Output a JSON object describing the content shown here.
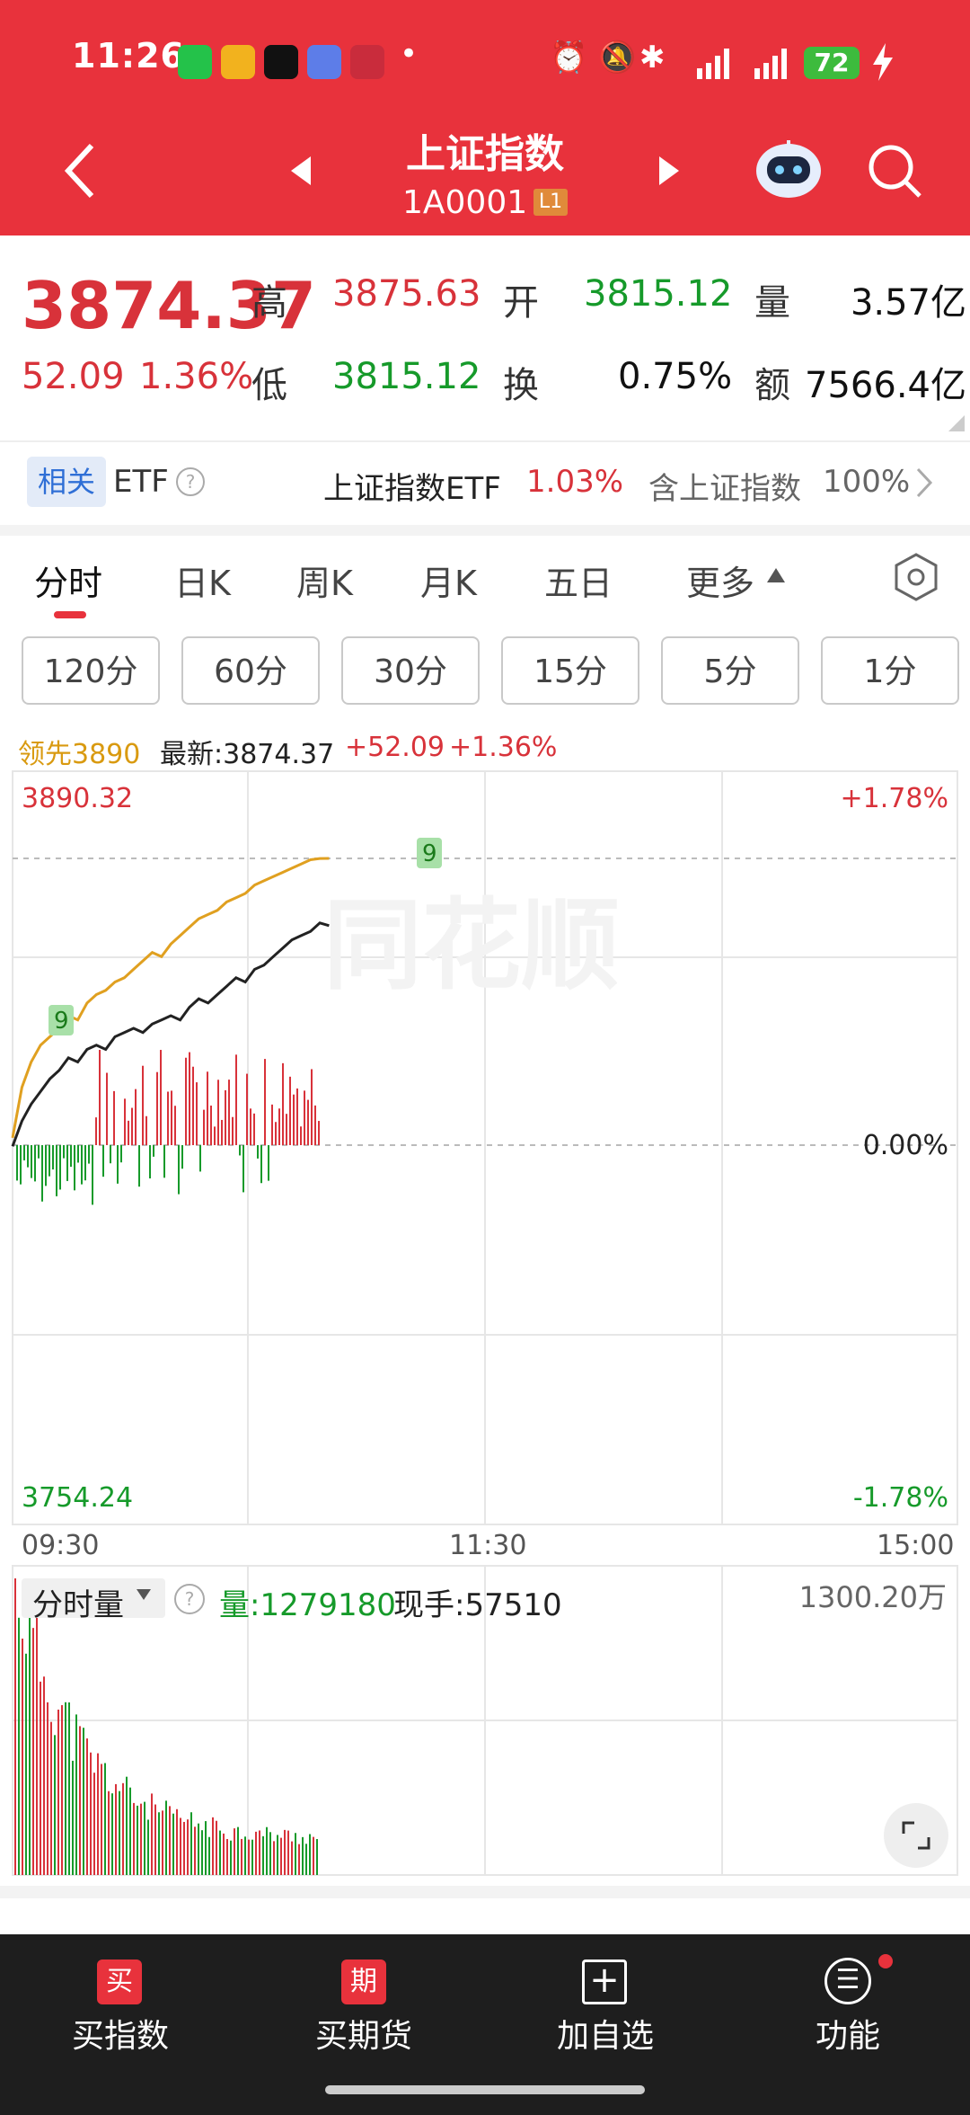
{
  "status_bar": {
    "time": "11:26",
    "dot": "•",
    "battery": "72"
  },
  "header": {
    "title": "上证指数",
    "code": "1A0001",
    "badge": "L1"
  },
  "quote": {
    "price": "3874.37",
    "change": "52.09",
    "change_pct": "1.36%",
    "high_label": "高",
    "high": "3875.63",
    "open_label": "开",
    "open": "3815.12",
    "volume_label": "量",
    "volume": "3.57亿",
    "low_label": "低",
    "low": "3815.12",
    "turnover_label": "换",
    "turnover": "0.75%",
    "amount_label": "额",
    "amount": "7566.4亿"
  },
  "related": {
    "tag": "相关",
    "etf": "ETF",
    "help": "?",
    "etf_name": "上证指数ETF",
    "etf_pct": "1.03%",
    "contains": "含上证指数",
    "contains_pct": "100%"
  },
  "tabs": [
    "分时",
    "日K",
    "周K",
    "月K",
    "五日",
    "更多"
  ],
  "periods": [
    "120分",
    "60分",
    "30分",
    "15分",
    "5分",
    "1分"
  ],
  "chart_info": {
    "lead": "领先3890",
    "latest": "最新:3874.37",
    "chg": "+52.09",
    "pct": "+1.36%"
  },
  "chart_data": {
    "type": "line",
    "y_top": "3890.32",
    "y_bottom": "3754.24",
    "pct_top": "+1.78%",
    "pct_mid": "0.00%",
    "pct_bottom": "-1.78%",
    "x_labels": [
      "09:30",
      "11:30",
      "15:00"
    ],
    "signal": "9",
    "ylim": [
      3754.24,
      3890.32
    ],
    "series": [
      {
        "values": [
          3822,
          3828,
          3832,
          3835,
          3838,
          3840,
          3843,
          3842,
          3845,
          3846,
          3845,
          3848,
          3849,
          3850,
          3849,
          3851,
          3852,
          3853,
          3852,
          3855,
          3857,
          3856,
          3858,
          3860,
          3862,
          3861,
          3864,
          3865,
          3867,
          3869,
          3871,
          3872,
          3873,
          3875,
          3874.37
        ]
      },
      {
        "values": [
          3824,
          3836,
          3842,
          3846,
          3848,
          3850,
          3853,
          3852,
          3856,
          3858,
          3859,
          3861,
          3862,
          3864,
          3866,
          3868,
          3867,
          3870,
          3872,
          3874,
          3876,
          3877,
          3878,
          3880,
          3881,
          3882,
          3884,
          3885,
          3886,
          3887,
          3888,
          3889,
          3890,
          3890.3,
          3890.32
        ]
      }
    ]
  },
  "volume_panel": {
    "label": "分时量",
    "help": "?",
    "vol": "量:1279180",
    "hand": "现手:57510",
    "max": "1300.20万"
  },
  "bottom_nav": [
    {
      "icon": "买",
      "label": "买指数"
    },
    {
      "icon": "期",
      "label": "买期货"
    },
    {
      "icon": "+",
      "label": "加自选"
    },
    {
      "icon": "☰",
      "label": "功能"
    }
  ],
  "colors": {
    "header": "#e8323c",
    "up": "#d8323a",
    "down": "#169a2a",
    "lead_line": "#e0a020"
  }
}
